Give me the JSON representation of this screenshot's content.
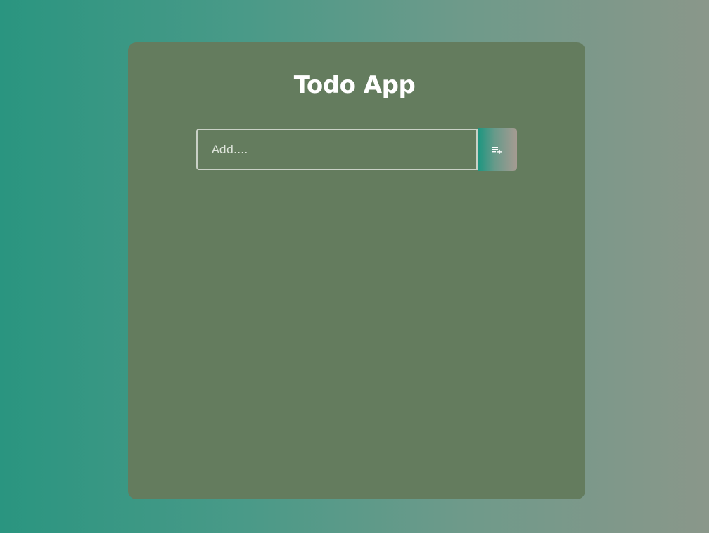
{
  "app": {
    "title": "Todo App"
  },
  "form": {
    "input_value": "",
    "input_placeholder": "Add....",
    "add_button_icon": "playlist-add-icon"
  },
  "colors": {
    "background_start": "#2a9580",
    "background_end": "#8a978a",
    "card": "#647c5e",
    "title": "#ffffff",
    "input_border": "#c9d1c6"
  },
  "todos": []
}
